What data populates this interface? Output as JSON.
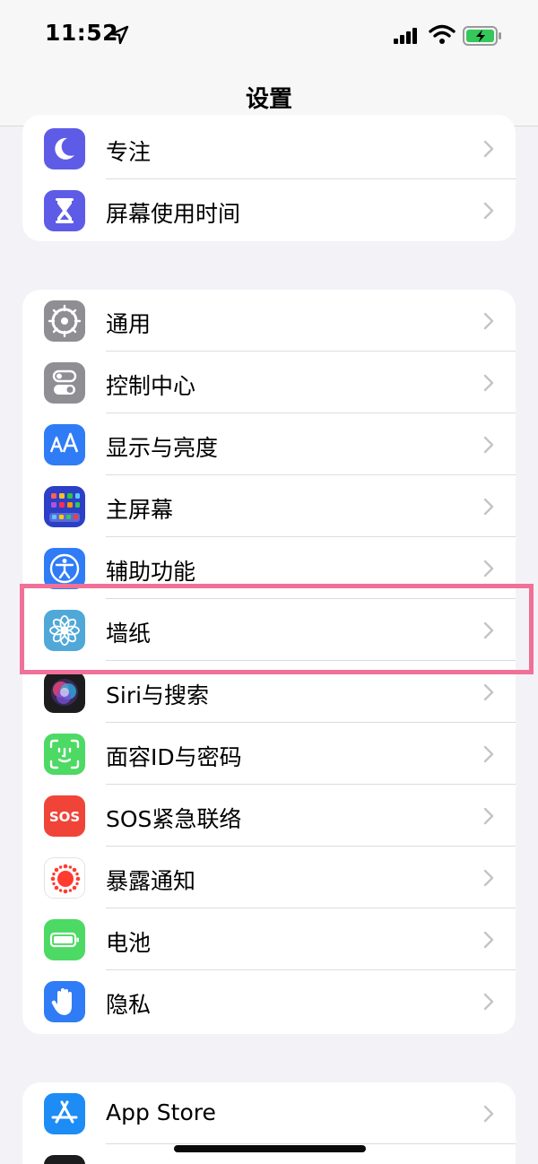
{
  "status_bar": {
    "time": "11:52",
    "icons": [
      "location-arrow-icon",
      "cellular-signal-icon",
      "wifi-icon",
      "battery-charging-icon"
    ]
  },
  "nav": {
    "title": "设置"
  },
  "groups": [
    {
      "items": [
        {
          "label": "专注",
          "icon": "moon-icon",
          "color": "#5e5ce6"
        },
        {
          "label": "屏幕使用时间",
          "icon": "hourglass-icon",
          "color": "#5e5ce6"
        }
      ]
    },
    {
      "items": [
        {
          "label": "通用",
          "icon": "gear-icon",
          "color": "#8e8e93"
        },
        {
          "label": "控制中心",
          "icon": "toggle-switches-icon",
          "color": "#8e8e93"
        },
        {
          "label": "显示与亮度",
          "icon": "text-size-icon",
          "color": "#2f7cf6"
        },
        {
          "label": "主屏幕",
          "icon": "app-grid-icon",
          "color": "#2c3fc7"
        },
        {
          "label": "辅助功能",
          "icon": "accessibility-icon",
          "color": "#2f7cf6"
        },
        {
          "label": "墙纸",
          "icon": "flower-icon",
          "color": "#4fa8d8"
        },
        {
          "label": "Siri与搜索",
          "icon": "siri-orb-icon",
          "color": "#1c1c1e"
        },
        {
          "label": "面容ID与密码",
          "icon": "face-id-icon",
          "color": "#4cd964"
        },
        {
          "label": "SOS紧急联络",
          "icon": "sos-icon",
          "color": "#f04438"
        },
        {
          "label": "暴露通知",
          "icon": "exposure-dots-icon",
          "color": "#ffffff"
        },
        {
          "label": "电池",
          "icon": "battery-icon",
          "color": "#4cd964"
        },
        {
          "label": "隐私",
          "icon": "hand-icon",
          "color": "#2f7cf6"
        }
      ]
    },
    {
      "items": [
        {
          "label": "App Store",
          "icon": "app-store-icon",
          "color": "#1d8cf5"
        }
      ]
    }
  ],
  "highlight": {
    "target": "墙纸",
    "color": "#f07098"
  }
}
